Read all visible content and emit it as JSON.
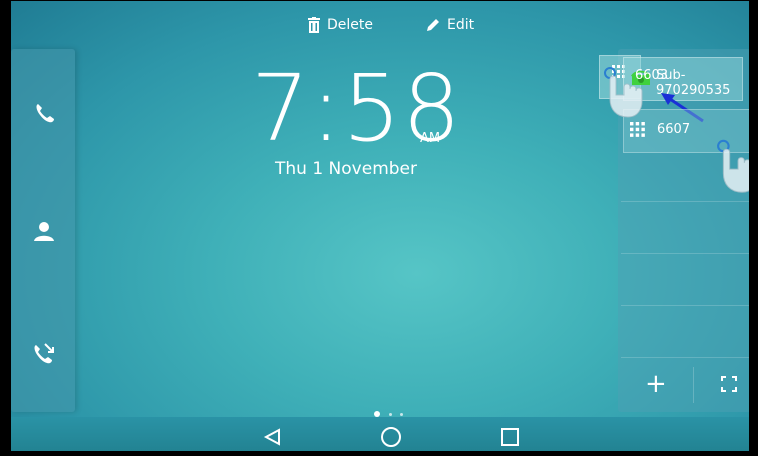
{
  "topbar": {
    "delete_label": "Delete",
    "edit_label": "Edit"
  },
  "left_panel": {
    "icons": [
      "phone-icon",
      "contact-icon",
      "call-forward-icon"
    ]
  },
  "clock": {
    "time": "7:58",
    "ampm": "AM",
    "date": "Thu 1 November"
  },
  "right_panel": {
    "dragging_key": {
      "label": "6603",
      "suffix": "Sub-970290535",
      "icon": "line-status-icon"
    },
    "key_6607": {
      "label": "6607",
      "icon": "dialpad-icon"
    },
    "add_label": "+",
    "expand_icon": "expand-icon"
  },
  "pager": {
    "active_index": 0,
    "count": 3
  },
  "navbar": {
    "icons": [
      "back-icon",
      "home-icon",
      "recents-icon"
    ]
  },
  "colors": {
    "accent_green": "#3fd13f",
    "arrow_blue": "#1a2fd6"
  }
}
